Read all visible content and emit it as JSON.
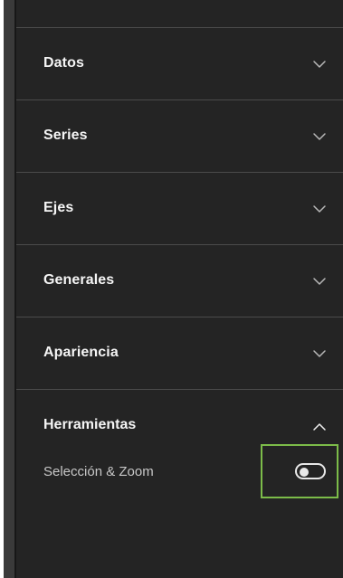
{
  "sections": [
    {
      "label": "Datos",
      "expanded": false,
      "icon": "chevron-down-icon"
    },
    {
      "label": "Series",
      "expanded": false,
      "icon": "chevron-down-icon"
    },
    {
      "label": "Ejes",
      "expanded": false,
      "icon": "chevron-down-icon"
    },
    {
      "label": "Generales",
      "expanded": false,
      "icon": "chevron-down-icon"
    },
    {
      "label": "Apariencia",
      "expanded": false,
      "icon": "chevron-down-icon"
    }
  ],
  "tools": {
    "label": "Herramientas",
    "expanded": true,
    "icon": "chevron-up-icon",
    "selection_zoom": {
      "label": "Selección & Zoom",
      "enabled": false
    }
  },
  "colors": {
    "panel_background": "#242424",
    "divider": "#4b4b4b",
    "highlight_outline": "#7cbc49",
    "toggle": "#e8e8e8"
  }
}
